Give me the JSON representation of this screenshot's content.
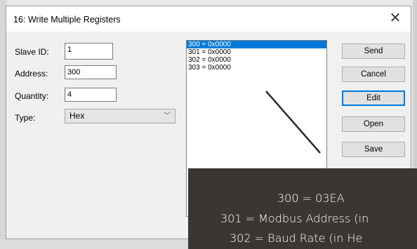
{
  "window": {
    "title": "16: Write Multiple Registers",
    "close_glyph": "✕"
  },
  "form": {
    "slave_id_label": "Slave ID:",
    "slave_id_value": "1",
    "address_label": "Address:",
    "address_value": "300",
    "quantity_label": "Quantity:",
    "quantity_value": "4",
    "type_label": "Type:",
    "type_value": "Hex"
  },
  "registers": [
    "300 = 0x0000",
    "301 = 0x0000",
    "302 = 0x0000",
    "303 = 0x0000"
  ],
  "selected_register_index": 0,
  "buttons": {
    "send": "Send",
    "cancel": "Cancel",
    "edit": "Edit",
    "open": "Open",
    "save": "Save"
  },
  "caption": {
    "line1": "300 = 03EA",
    "line2": "301 = Modbus Address (in",
    "line3": "302 = Baud Rate (in He"
  },
  "colors": {
    "selection": "#0078d7",
    "caption_bg": "#3a3633"
  }
}
